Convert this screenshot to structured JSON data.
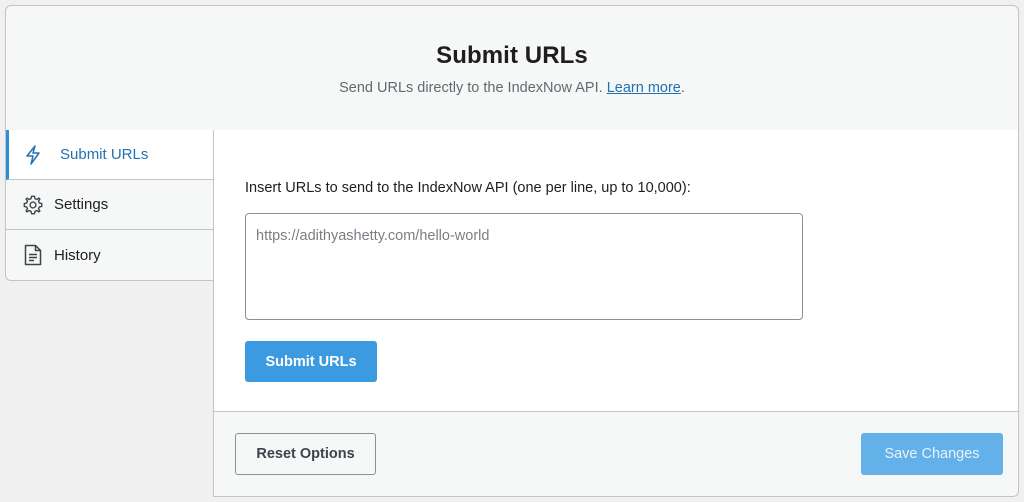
{
  "header": {
    "title": "Submit URLs",
    "subtitle": "Send URLs directly to the IndexNow API.",
    "learn_more": "Learn more",
    "period": "."
  },
  "tabs": [
    {
      "label": "Submit URLs",
      "icon": "lightning-icon",
      "active": true
    },
    {
      "label": "Settings",
      "icon": "gear-icon",
      "active": false
    },
    {
      "label": "History",
      "icon": "document-icon",
      "active": false
    }
  ],
  "form": {
    "prompt": "Insert URLs to send to the IndexNow API (one per line, up to 10,000):",
    "urls_value": "",
    "urls_placeholder": "https://adithyashetty.com/hello-world",
    "submit_label": "Submit URLs"
  },
  "footer": {
    "reset_label": "Reset Options",
    "save_label": "Save Changes"
  },
  "colors": {
    "accent": "#2271b1",
    "primary_button": "#3c9be0",
    "disabled_button": "#64b1e9"
  }
}
